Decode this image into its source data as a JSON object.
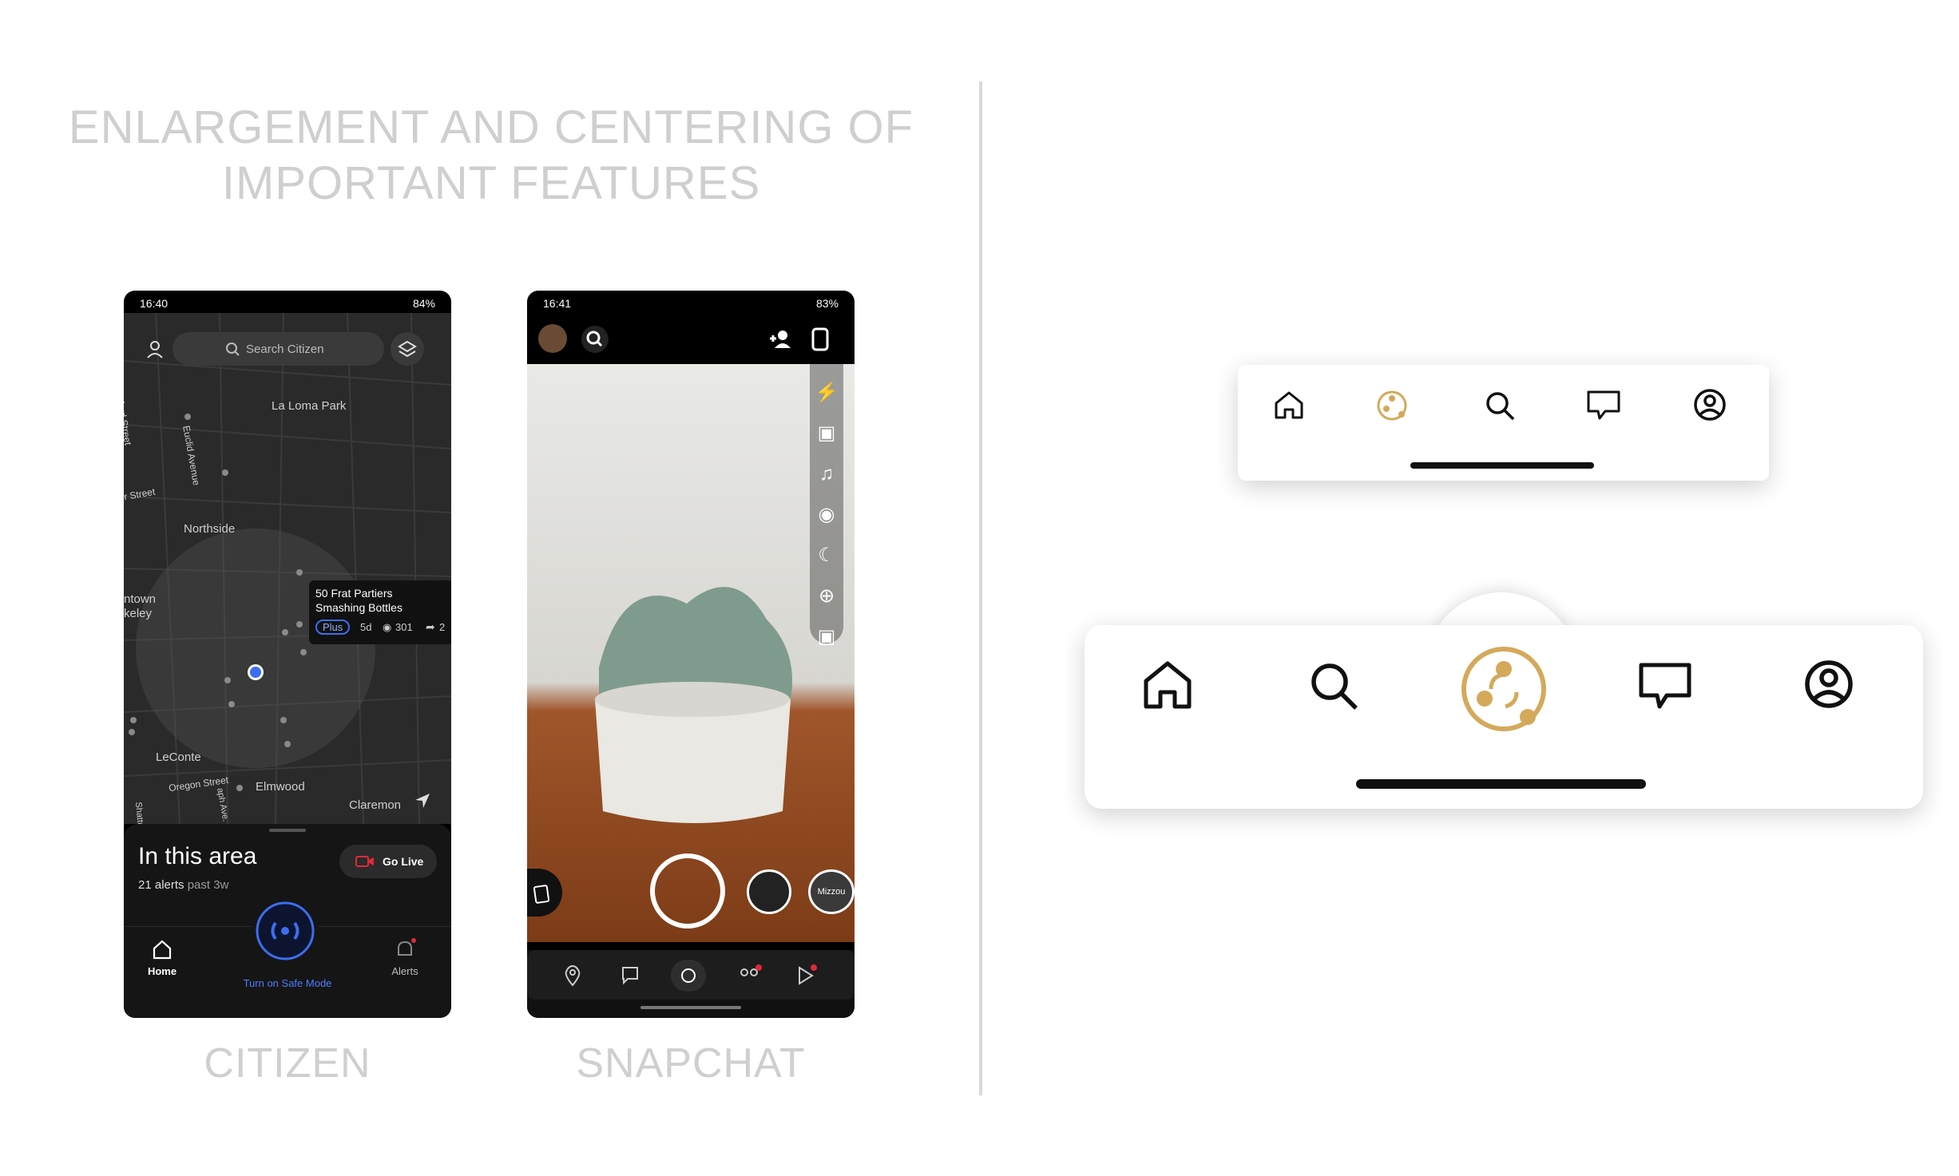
{
  "heading": {
    "line1": "ENLARGEMENT AND CENTERING OF",
    "line2": "IMPORTANT FEATURES"
  },
  "captions": {
    "left": "CITIZEN",
    "right": "SNAPCHAT"
  },
  "citizen": {
    "status_time": "16:40",
    "status_right": "84%",
    "search_placeholder": "Search Citizen",
    "map_labels": [
      "La Loma Park",
      "Northside",
      "LeConte",
      "Elmwood",
      "Claremon",
      "Oxford Street",
      "Euclid Avenue",
      "r Street",
      "ntown",
      "keley",
      "Oregon Street",
      "Shattu",
      "aph Ave."
    ],
    "incident": {
      "title_line1": "50 Frat Partiers",
      "title_line2": "Smashing Bottles",
      "badge": "Plus",
      "age": "5d",
      "views": "301",
      "shares": "2"
    },
    "sheet": {
      "title": "In this area",
      "alerts_count": "21 alerts",
      "alerts_period": "past 3w",
      "go_live": "Go Live"
    },
    "nav": {
      "home": "Home",
      "safe_mode": "Turn on Safe Mode",
      "alerts": "Alerts"
    },
    "colors": {
      "accent": "#3d6ef0",
      "live_red": "#e0283c"
    }
  },
  "snapchat": {
    "status_time": "16:41",
    "status_right": "83%",
    "side_tools": [
      "flash-off-icon",
      "video-icon",
      "music-icon",
      "camera-icon",
      "night-icon",
      "plus-icon",
      "scan-icon"
    ],
    "lens_label": "Mizzou"
  },
  "bars": {
    "accent": "#d4a95a"
  }
}
